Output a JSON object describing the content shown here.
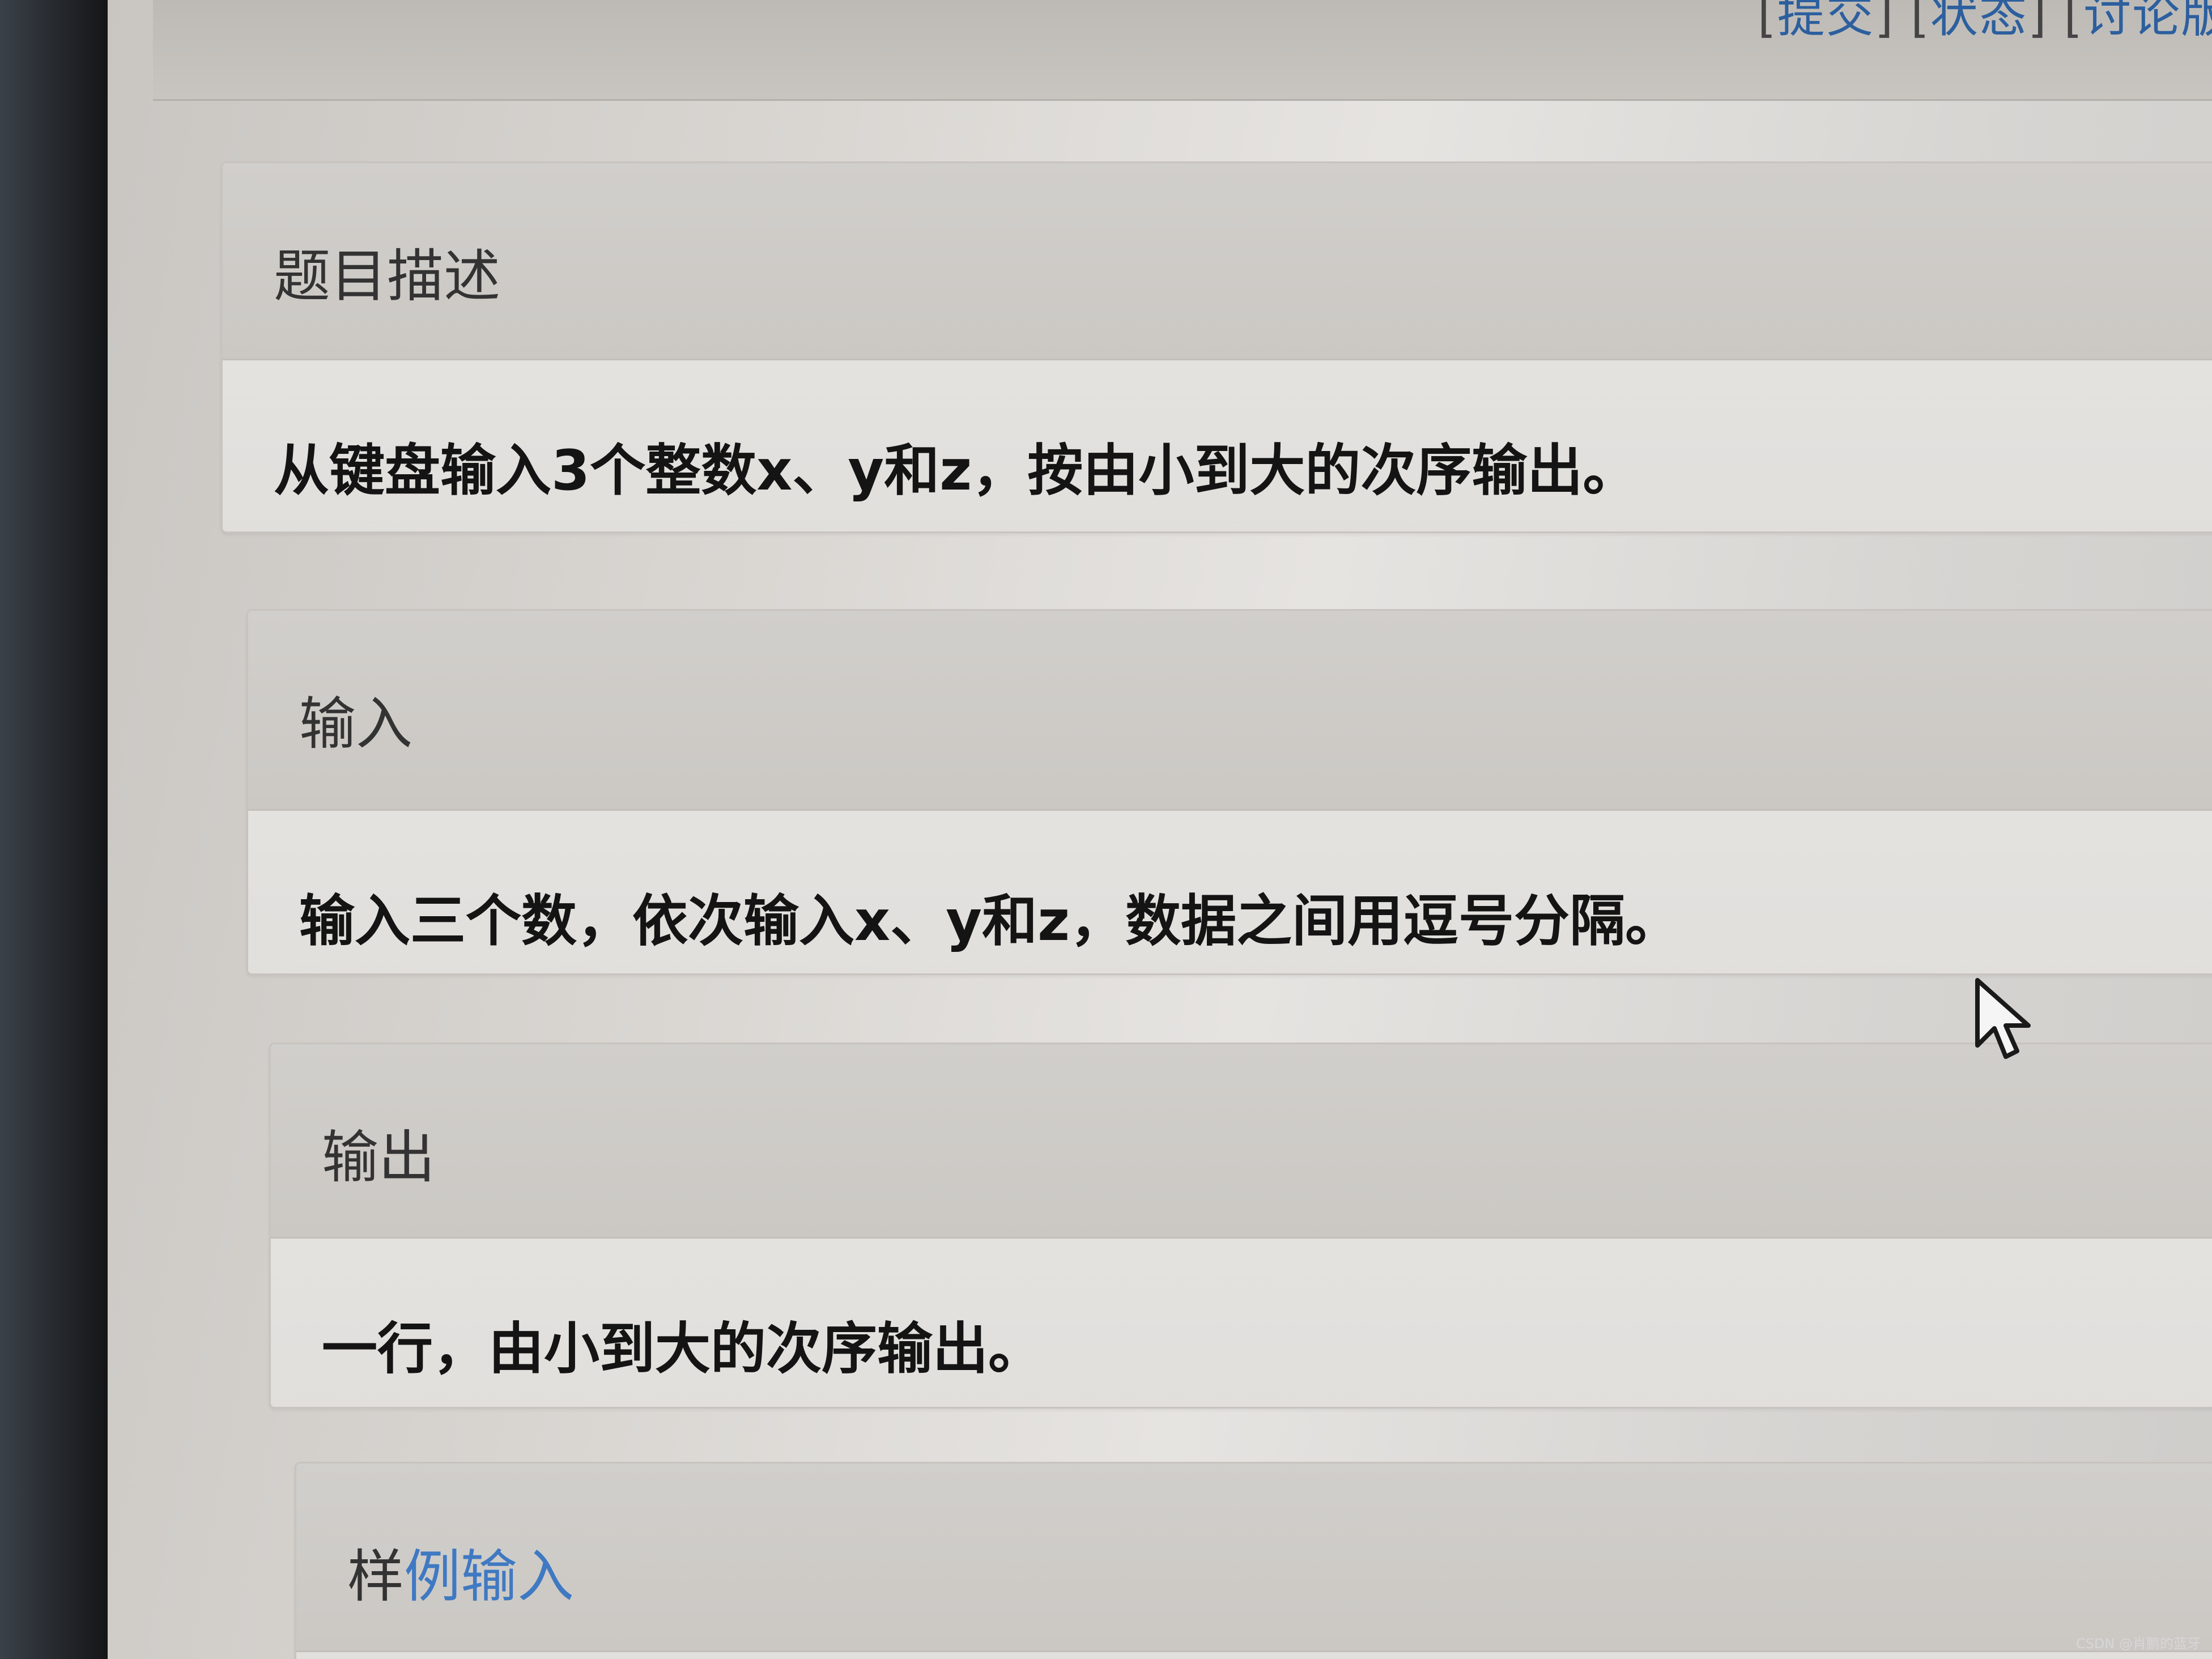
{
  "header": {
    "links": [
      {
        "label": "提交"
      },
      {
        "label": "状态"
      },
      {
        "label": "讨论版"
      }
    ]
  },
  "sections": {
    "description": {
      "title": "题目描述",
      "content": "从键盘输入3个整数x、y和z，按由小到大的次序输出。"
    },
    "input": {
      "title": "输入",
      "content": "输入三个数，依次输入x、y和z，数据之间用逗号分隔。"
    },
    "output": {
      "title": "输出",
      "content": "一行，由小到大的次序输出。"
    },
    "sample_input": {
      "title_plain": "样",
      "title_link": "例输入"
    }
  },
  "watermark": "CSDN @肖鹏的蓝牙",
  "colors": {
    "link": "#2c5f9e",
    "link_light": "#3f79c2",
    "panel_head": "#cbc8c4",
    "panel_body": "#e2e0dd",
    "text_dark": "#141414"
  }
}
